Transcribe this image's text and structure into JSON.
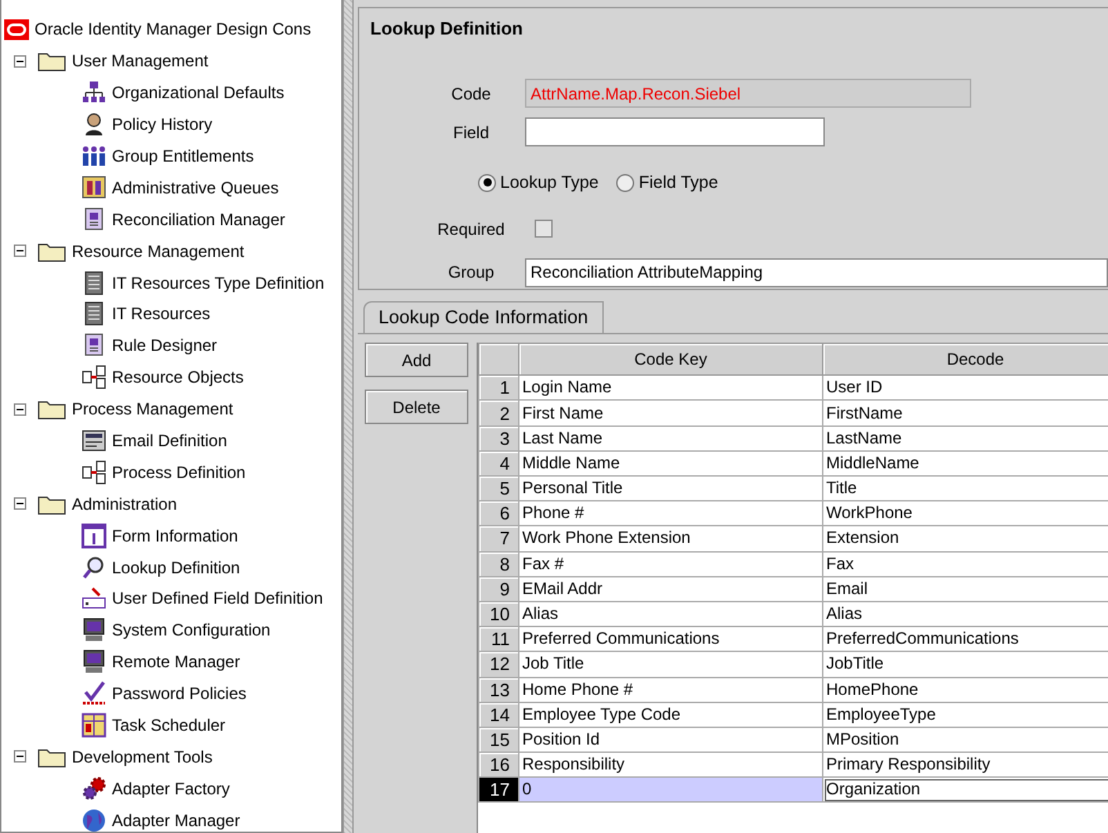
{
  "tree": {
    "root_label": "Oracle Identity Manager Design Cons",
    "groups": [
      {
        "label": "User Management",
        "expanded": true,
        "children": [
          {
            "label": "Organizational Defaults"
          },
          {
            "label": "Policy History"
          },
          {
            "label": "Group Entitlements"
          },
          {
            "label": "Administrative Queues"
          },
          {
            "label": "Reconciliation Manager"
          }
        ]
      },
      {
        "label": "Resource Management",
        "expanded": true,
        "children": [
          {
            "label": "IT Resources Type Definition"
          },
          {
            "label": "IT Resources"
          },
          {
            "label": "Rule Designer"
          },
          {
            "label": "Resource Objects"
          }
        ]
      },
      {
        "label": "Process Management",
        "expanded": true,
        "children": [
          {
            "label": "Email Definition"
          },
          {
            "label": "Process Definition"
          }
        ]
      },
      {
        "label": "Administration",
        "expanded": true,
        "children": [
          {
            "label": "Form Information"
          },
          {
            "label": "Lookup Definition"
          },
          {
            "label": "User Defined Field Definition"
          },
          {
            "label": "System Configuration"
          },
          {
            "label": "Remote Manager"
          },
          {
            "label": "Password Policies"
          },
          {
            "label": "Task Scheduler"
          }
        ]
      },
      {
        "label": "Development Tools",
        "expanded": true,
        "children": [
          {
            "label": "Adapter Factory"
          },
          {
            "label": "Adapter Manager"
          }
        ]
      }
    ]
  },
  "form": {
    "title": "Lookup Definition",
    "code": {
      "label": "Code",
      "value": "AttrName.Map.Recon.Siebel",
      "read_only": true
    },
    "field": {
      "label": "Field"
    },
    "type_options": [
      {
        "label": "Lookup Type",
        "selected": true
      },
      {
        "label": "Field Type",
        "selected": false
      }
    ],
    "required": {
      "label": "Required",
      "checked": false
    },
    "group": {
      "label": "Group",
      "value": "Reconciliation AttributeMapping"
    }
  },
  "tabs": [
    {
      "label": "Lookup Code Information",
      "selected": true
    }
  ],
  "buttons": [
    "Add",
    "Delete"
  ],
  "table": {
    "columns": [
      "Code Key",
      "Decode"
    ],
    "rows": [
      {
        "number": "1",
        "code_key": "Login Name",
        "decode": "User ID",
        "selected": false
      },
      {
        "number": "2",
        "code_key": "First Name",
        "decode": "FirstName",
        "selected": false
      },
      {
        "number": "3",
        "code_key": "Last Name",
        "decode": "LastName",
        "selected": false
      },
      {
        "number": "4",
        "code_key": "Middle Name",
        "decode": "MiddleName",
        "selected": false
      },
      {
        "number": "5",
        "code_key": "Personal Title",
        "decode": "Title",
        "selected": false
      },
      {
        "number": "6",
        "code_key": "Phone #",
        "decode": "WorkPhone",
        "selected": false
      },
      {
        "number": "7",
        "code_key": "Work Phone Extension",
        "decode": "Extension",
        "selected": false
      },
      {
        "number": "8",
        "code_key": "Fax #",
        "decode": "Fax",
        "selected": false
      },
      {
        "number": "9",
        "code_key": "EMail Addr",
        "decode": "Email",
        "selected": false
      },
      {
        "number": "10",
        "code_key": "Alias",
        "decode": "Alias",
        "selected": false
      },
      {
        "number": "11",
        "code_key": "Preferred Communications",
        "decode": "PreferredCommunications",
        "selected": false
      },
      {
        "number": "12",
        "code_key": "Job Title",
        "decode": "JobTitle",
        "selected": false
      },
      {
        "number": "13",
        "code_key": "Home Phone #",
        "decode": "HomePhone",
        "selected": false
      },
      {
        "number": "14",
        "code_key": "Employee Type Code",
        "decode": "EmployeeType",
        "selected": false
      },
      {
        "number": "15",
        "code_key": "Position Id",
        "decode": "MPosition",
        "selected": false
      },
      {
        "number": "16",
        "code_key": "Responsibility",
        "decode": "Primary Responsibility",
        "selected": false
      },
      {
        "number": "17",
        "code_key": "0",
        "decode": "Organization",
        "selected": true
      }
    ]
  }
}
